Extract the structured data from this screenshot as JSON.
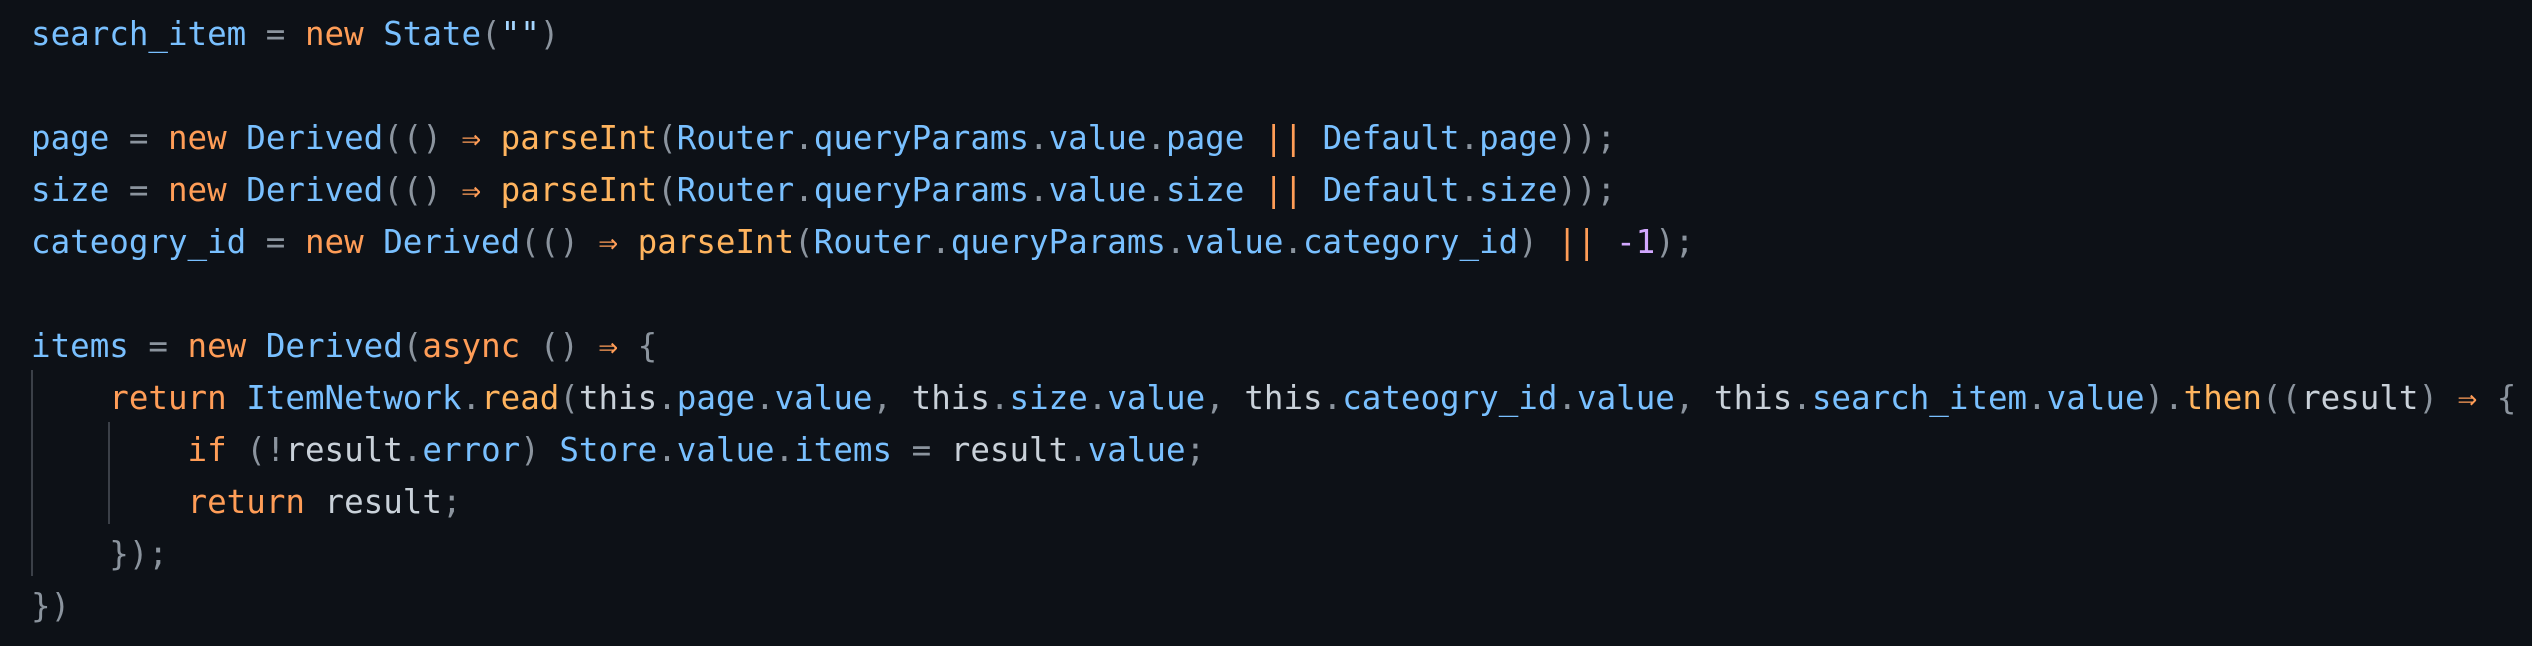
{
  "colors": {
    "background": "#0d1117",
    "variable": "#79c0ff",
    "keyword": "#ff9d57",
    "function": "#ffb45e",
    "method": "#ffb45e",
    "class": "#79c0ff",
    "property": "#79c0ff",
    "plain": "#c9d1d9",
    "punctuation": "#8b949e",
    "string": "#a5d6ff",
    "number": "#d2a8ff",
    "operator": "#ff9d57"
  },
  "editor": {
    "lines": [
      {
        "tokens": [
          {
            "t": "search_item",
            "k": "variable"
          },
          {
            "t": " = ",
            "k": "punctuation"
          },
          {
            "t": "new",
            "k": "keyword"
          },
          {
            "t": " ",
            "k": "plain"
          },
          {
            "t": "State",
            "k": "class"
          },
          {
            "t": "(",
            "k": "punctuation"
          },
          {
            "t": "\"\"",
            "k": "string"
          },
          {
            "t": ")",
            "k": "punctuation"
          }
        ]
      },
      {
        "tokens": []
      },
      {
        "tokens": [
          {
            "t": "page",
            "k": "variable"
          },
          {
            "t": " = ",
            "k": "punctuation"
          },
          {
            "t": "new",
            "k": "keyword"
          },
          {
            "t": " ",
            "k": "plain"
          },
          {
            "t": "Derived",
            "k": "class"
          },
          {
            "t": "(() ",
            "k": "punctuation"
          },
          {
            "t": "⇒",
            "k": "operator"
          },
          {
            "t": " ",
            "k": "plain"
          },
          {
            "t": "parseInt",
            "k": "function"
          },
          {
            "t": "(",
            "k": "punctuation"
          },
          {
            "t": "Router",
            "k": "class"
          },
          {
            "t": ".",
            "k": "punctuation"
          },
          {
            "t": "queryParams",
            "k": "property"
          },
          {
            "t": ".",
            "k": "punctuation"
          },
          {
            "t": "value",
            "k": "property"
          },
          {
            "t": ".",
            "k": "punctuation"
          },
          {
            "t": "page",
            "k": "property"
          },
          {
            "t": " ",
            "k": "plain"
          },
          {
            "t": "||",
            "k": "operator"
          },
          {
            "t": " ",
            "k": "plain"
          },
          {
            "t": "Default",
            "k": "class"
          },
          {
            "t": ".",
            "k": "punctuation"
          },
          {
            "t": "page",
            "k": "property"
          },
          {
            "t": "));",
            "k": "punctuation"
          }
        ]
      },
      {
        "tokens": [
          {
            "t": "size",
            "k": "variable"
          },
          {
            "t": " = ",
            "k": "punctuation"
          },
          {
            "t": "new",
            "k": "keyword"
          },
          {
            "t": " ",
            "k": "plain"
          },
          {
            "t": "Derived",
            "k": "class"
          },
          {
            "t": "(() ",
            "k": "punctuation"
          },
          {
            "t": "⇒",
            "k": "operator"
          },
          {
            "t": " ",
            "k": "plain"
          },
          {
            "t": "parseInt",
            "k": "function"
          },
          {
            "t": "(",
            "k": "punctuation"
          },
          {
            "t": "Router",
            "k": "class"
          },
          {
            "t": ".",
            "k": "punctuation"
          },
          {
            "t": "queryParams",
            "k": "property"
          },
          {
            "t": ".",
            "k": "punctuation"
          },
          {
            "t": "value",
            "k": "property"
          },
          {
            "t": ".",
            "k": "punctuation"
          },
          {
            "t": "size",
            "k": "property"
          },
          {
            "t": " ",
            "k": "plain"
          },
          {
            "t": "||",
            "k": "operator"
          },
          {
            "t": " ",
            "k": "plain"
          },
          {
            "t": "Default",
            "k": "class"
          },
          {
            "t": ".",
            "k": "punctuation"
          },
          {
            "t": "size",
            "k": "property"
          },
          {
            "t": "));",
            "k": "punctuation"
          }
        ]
      },
      {
        "tokens": [
          {
            "t": "cateogry_id",
            "k": "variable"
          },
          {
            "t": " = ",
            "k": "punctuation"
          },
          {
            "t": "new",
            "k": "keyword"
          },
          {
            "t": " ",
            "k": "plain"
          },
          {
            "t": "Derived",
            "k": "class"
          },
          {
            "t": "(() ",
            "k": "punctuation"
          },
          {
            "t": "⇒",
            "k": "operator"
          },
          {
            "t": " ",
            "k": "plain"
          },
          {
            "t": "parseInt",
            "k": "function"
          },
          {
            "t": "(",
            "k": "punctuation"
          },
          {
            "t": "Router",
            "k": "class"
          },
          {
            "t": ".",
            "k": "punctuation"
          },
          {
            "t": "queryParams",
            "k": "property"
          },
          {
            "t": ".",
            "k": "punctuation"
          },
          {
            "t": "value",
            "k": "property"
          },
          {
            "t": ".",
            "k": "punctuation"
          },
          {
            "t": "category_id",
            "k": "property"
          },
          {
            "t": ") ",
            "k": "punctuation"
          },
          {
            "t": "||",
            "k": "operator"
          },
          {
            "t": " ",
            "k": "plain"
          },
          {
            "t": "-1",
            "k": "number"
          },
          {
            "t": ");",
            "k": "punctuation"
          }
        ]
      },
      {
        "tokens": []
      },
      {
        "tokens": [
          {
            "t": "items",
            "k": "variable"
          },
          {
            "t": " = ",
            "k": "punctuation"
          },
          {
            "t": "new",
            "k": "keyword"
          },
          {
            "t": " ",
            "k": "plain"
          },
          {
            "t": "Derived",
            "k": "class"
          },
          {
            "t": "(",
            "k": "punctuation"
          },
          {
            "t": "async",
            "k": "keyword"
          },
          {
            "t": " () ",
            "k": "punctuation"
          },
          {
            "t": "⇒",
            "k": "operator"
          },
          {
            "t": " {",
            "k": "punctuation"
          }
        ]
      },
      {
        "tokens": [
          {
            "t": "    ",
            "k": "plain"
          },
          {
            "t": "return",
            "k": "keyword"
          },
          {
            "t": " ",
            "k": "plain"
          },
          {
            "t": "ItemNetwork",
            "k": "class"
          },
          {
            "t": ".",
            "k": "punctuation"
          },
          {
            "t": "read",
            "k": "method"
          },
          {
            "t": "(",
            "k": "punctuation"
          },
          {
            "t": "this",
            "k": "plain"
          },
          {
            "t": ".",
            "k": "punctuation"
          },
          {
            "t": "page",
            "k": "property"
          },
          {
            "t": ".",
            "k": "punctuation"
          },
          {
            "t": "value",
            "k": "property"
          },
          {
            "t": ", ",
            "k": "punctuation"
          },
          {
            "t": "this",
            "k": "plain"
          },
          {
            "t": ".",
            "k": "punctuation"
          },
          {
            "t": "size",
            "k": "property"
          },
          {
            "t": ".",
            "k": "punctuation"
          },
          {
            "t": "value",
            "k": "property"
          },
          {
            "t": ", ",
            "k": "punctuation"
          },
          {
            "t": "this",
            "k": "plain"
          },
          {
            "t": ".",
            "k": "punctuation"
          },
          {
            "t": "cateogry_id",
            "k": "property"
          },
          {
            "t": ".",
            "k": "punctuation"
          },
          {
            "t": "value",
            "k": "property"
          },
          {
            "t": ", ",
            "k": "punctuation"
          },
          {
            "t": "this",
            "k": "plain"
          },
          {
            "t": ".",
            "k": "punctuation"
          },
          {
            "t": "search_item",
            "k": "property"
          },
          {
            "t": ".",
            "k": "punctuation"
          },
          {
            "t": "value",
            "k": "property"
          },
          {
            "t": ").",
            "k": "punctuation"
          },
          {
            "t": "then",
            "k": "method"
          },
          {
            "t": "((",
            "k": "punctuation"
          },
          {
            "t": "result",
            "k": "plain"
          },
          {
            "t": ") ",
            "k": "punctuation"
          },
          {
            "t": "⇒",
            "k": "operator"
          },
          {
            "t": " {",
            "k": "punctuation"
          }
        ]
      },
      {
        "tokens": [
          {
            "t": "        ",
            "k": "plain"
          },
          {
            "t": "if",
            "k": "keyword"
          },
          {
            "t": " (!",
            "k": "punctuation"
          },
          {
            "t": "result",
            "k": "plain"
          },
          {
            "t": ".",
            "k": "punctuation"
          },
          {
            "t": "error",
            "k": "property"
          },
          {
            "t": ") ",
            "k": "punctuation"
          },
          {
            "t": "Store",
            "k": "class"
          },
          {
            "t": ".",
            "k": "punctuation"
          },
          {
            "t": "value",
            "k": "property"
          },
          {
            "t": ".",
            "k": "punctuation"
          },
          {
            "t": "items",
            "k": "property"
          },
          {
            "t": " = ",
            "k": "punctuation"
          },
          {
            "t": "result",
            "k": "plain"
          },
          {
            "t": ".",
            "k": "punctuation"
          },
          {
            "t": "value",
            "k": "property"
          },
          {
            "t": ";",
            "k": "punctuation"
          }
        ]
      },
      {
        "tokens": [
          {
            "t": "        ",
            "k": "plain"
          },
          {
            "t": "return",
            "k": "keyword"
          },
          {
            "t": " ",
            "k": "plain"
          },
          {
            "t": "result",
            "k": "plain"
          },
          {
            "t": ";",
            "k": "punctuation"
          }
        ]
      },
      {
        "tokens": [
          {
            "t": "    ",
            "k": "plain"
          },
          {
            "t": "});",
            "k": "punctuation"
          }
        ]
      },
      {
        "tokens": [
          {
            "t": "})",
            "k": "punctuation"
          }
        ]
      }
    ]
  }
}
